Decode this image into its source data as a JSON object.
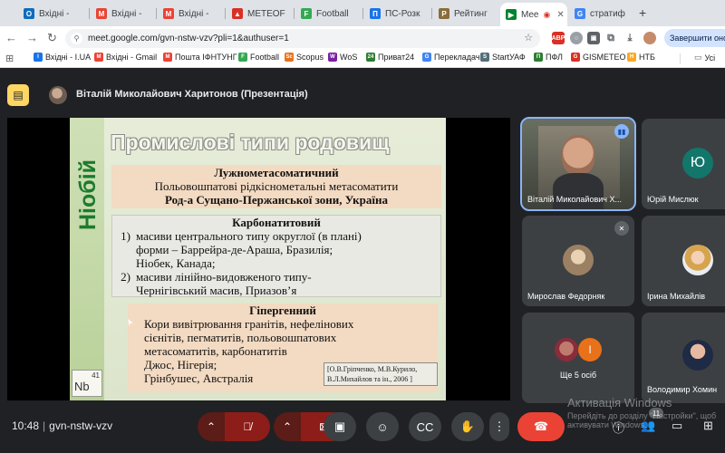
{
  "browser": {
    "tabs": [
      {
        "label": "Вхідні - ",
        "icon": "outlook-icon",
        "color": "#0f6cbd",
        "glyph": "O"
      },
      {
        "label": "Вхідні -",
        "icon": "gmail-icon",
        "color": "#ea4335",
        "glyph": "M"
      },
      {
        "label": "Вхідні -",
        "icon": "gmail-icon",
        "color": "#ea4335",
        "glyph": "M"
      },
      {
        "label": "METEOF",
        "icon": "meteo-icon",
        "color": "#d93025",
        "glyph": "▲"
      },
      {
        "label": "Football",
        "icon": "football-icon",
        "color": "#34a853",
        "glyph": "F"
      },
      {
        "label": "ПС-Розк",
        "icon": "doc-icon",
        "color": "#1a73e8",
        "glyph": "П"
      },
      {
        "label": "Рейтинг",
        "icon": "shield-icon",
        "color": "#8a6d3b",
        "glyph": "Р"
      },
      {
        "label": "Mee",
        "icon": "meet-icon",
        "color": "#00832d",
        "glyph": "▶"
      },
      {
        "label": "стратиф",
        "icon": "google-icon",
        "color": "#4285f4",
        "glyph": "G"
      }
    ],
    "url": "meet.google.com/gvn-nstw-vzv?pli=1&authuser=1",
    "finish_button": "Завершити онов",
    "bookmarks": [
      {
        "label": "Вхідні - I.UA",
        "color": "#1a73e8",
        "glyph": "I"
      },
      {
        "label": "Вхідні - Gmail",
        "color": "#ea4335",
        "glyph": "M"
      },
      {
        "label": "Пошта ІФНТУНГ",
        "color": "#ea4335",
        "glyph": "M"
      },
      {
        "label": "Football",
        "color": "#34a853",
        "glyph": "F"
      },
      {
        "label": "Scopus",
        "color": "#e8711a",
        "glyph": "Sc"
      },
      {
        "label": "WoS",
        "color": "#7b1fa2",
        "glyph": "W"
      },
      {
        "label": "Приват24",
        "color": "#2e7d32",
        "glyph": "24"
      },
      {
        "label": "Перекладач",
        "color": "#4285f4",
        "glyph": "G"
      },
      {
        "label": "StartУАФ",
        "color": "#546e7a",
        "glyph": "S"
      },
      {
        "label": "ПФЛ",
        "color": "#2e7d32",
        "glyph": "П"
      },
      {
        "label": "GISMETEO",
        "color": "#d93025",
        "glyph": "G"
      },
      {
        "label": "НТБ",
        "color": "#f9a825",
        "glyph": "Н"
      }
    ],
    "bookmarks_overflow": "Усі"
  },
  "meet": {
    "presenter_label": "Віталій Миколайович Харитонов (Презентація)",
    "code": "gvn-nstw-vzv",
    "time": "10:48",
    "participants_badge": "11",
    "tiles": [
      {
        "name": "Віталій Миколайович Х...",
        "type": "video"
      },
      {
        "name": "Юрій Мислюк",
        "type": "letter",
        "letter": "Ю",
        "color": "#12766b"
      },
      {
        "name": "Мирослав Федорняк",
        "type": "photo"
      },
      {
        "name": "Ірина Михайлів",
        "type": "photo"
      },
      {
        "name": "Ще 5 осіб",
        "type": "group",
        "letter": "І",
        "color": "#e8711a"
      },
      {
        "name": "Володимир Хомин",
        "type": "photo"
      }
    ]
  },
  "slide": {
    "side_label": "Ніобій",
    "title": "Промислові типи родовищ",
    "box1": {
      "heading": "Лужнометасоматичний",
      "line1": "Польовошпатові рідкіснометальні метасоматити",
      "line2": "Род-а Сущано-Пержанської зони, Україна"
    },
    "box2": {
      "heading": "Карбонатитовий",
      "items": [
        {
          "num": "1)",
          "lines": [
            "масиви центрального типу округлої (в плані)",
            "форми – Баррейра-де-Араша, Бразилія;",
            "Ніобек, Канада;"
          ]
        },
        {
          "num": "2)",
          "lines": [
            "масиви лінійно-видовженого типу-",
            "Чернігівський масив, Приазов’я"
          ]
        }
      ]
    },
    "box3": {
      "heading": "Гіпергенний",
      "lines": [
        "Кори вивітрювання гранітів, нефелінових",
        "сієнітів, пегматитів, польовошпатових",
        "метасоматитів, карбонатитів",
        "Джос, Нігерія;",
        "Грінбушес, Австралія"
      ]
    },
    "reference": "[О.В.Гріпченко, М.В.Курило, В.Л.Михайлов та ін., 2006 ]",
    "element_symbol": "Nb",
    "element_number": "41"
  },
  "watermark": {
    "title": "Активація Windows",
    "subtitle": "Перейдіть до розділу \"Настройки\", щоб",
    "subtitle2": "активувати Windows."
  }
}
